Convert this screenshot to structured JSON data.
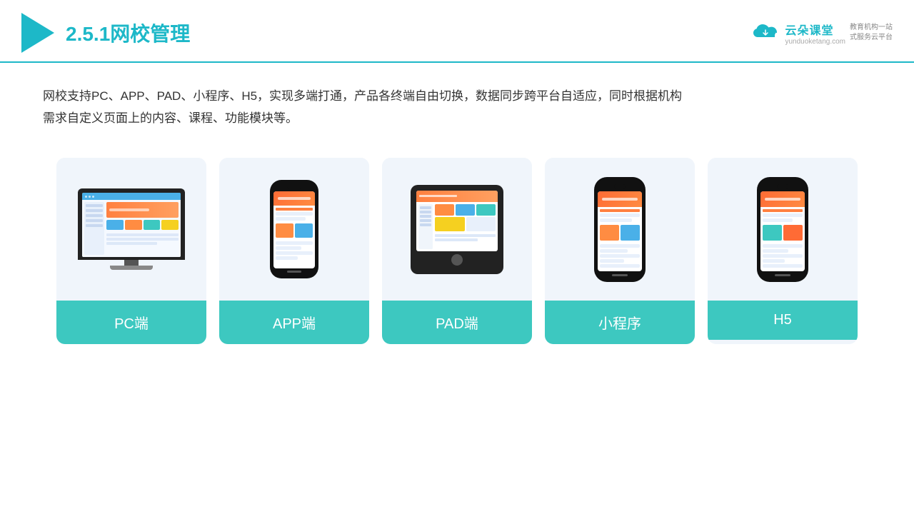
{
  "header": {
    "title_prefix": "2.5.1",
    "title_main": "网校管理",
    "logo_name": "云朵课堂",
    "logo_url": "yunduoketang.com",
    "logo_tagline": "教育机构一站\n式服务云平台"
  },
  "description": {
    "text1": "网校支持PC、APP、PAD、小程序、H5，实现多端打通，产品各终端自由切换，数据同步跨平台自适应，同时根据机构",
    "text2": "需求自定义页面上的内容、课程、功能模块等。"
  },
  "cards": [
    {
      "id": "pc",
      "label": "PC端"
    },
    {
      "id": "app",
      "label": "APP端"
    },
    {
      "id": "pad",
      "label": "PAD端"
    },
    {
      "id": "miniprogram",
      "label": "小程序"
    },
    {
      "id": "h5",
      "label": "H5"
    }
  ],
  "colors": {
    "teal": "#3dc8c0",
    "accent": "#1db8c8",
    "card_bg": "#f0f5fb"
  }
}
